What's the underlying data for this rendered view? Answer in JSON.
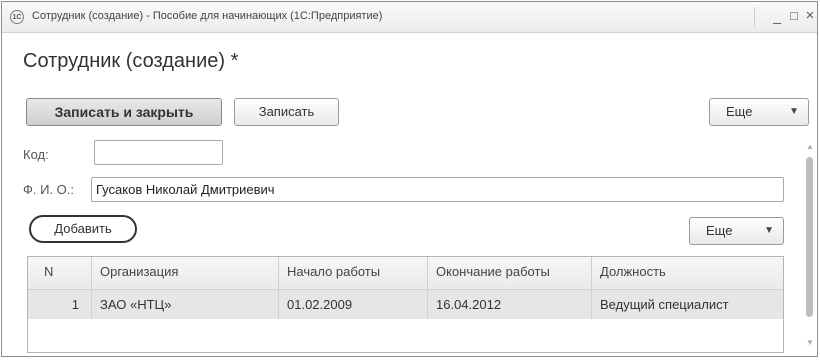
{
  "window": {
    "title": "Сотрудник (создание) - Пособие для начинающих  (1С:Предприятие)",
    "app_icon_text": "1С",
    "minimize": "_",
    "maximize": "□",
    "close": "×"
  },
  "form": {
    "title": "Сотрудник (создание) *"
  },
  "toolbar": {
    "save_close_label": "Записать и закрыть",
    "save_label": "Записать",
    "more_label": "Еще"
  },
  "fields": {
    "code_label": "Код:",
    "code_value": "",
    "fio_label": "Ф. И. О.:",
    "fio_value": "Гусаков Николай Дмитриевич"
  },
  "table_toolbar": {
    "add_label": "Добавить",
    "more_label": "Еще"
  },
  "table": {
    "columns": [
      "N",
      "Организация",
      "Начало работы",
      "Окончание работы",
      "Должность"
    ],
    "rows": [
      [
        "1",
        "ЗАО «НТЦ»",
        "01.02.2009",
        "16.04.2012",
        "Ведущий специалист"
      ]
    ]
  },
  "icons": {
    "caret": "chevron-down-icon",
    "scroll_up": "scroll-up-icon",
    "scroll_down": "scroll-down-icon"
  }
}
